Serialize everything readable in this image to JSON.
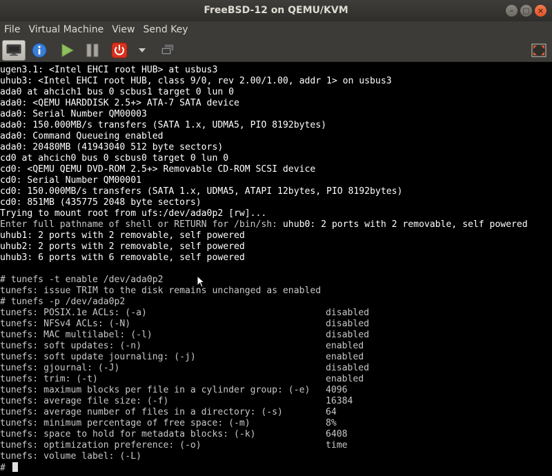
{
  "window": {
    "title": "FreeBSD-12 on QEMU/KVM",
    "controls": [
      "–",
      "□",
      "×"
    ]
  },
  "menubar": {
    "items": [
      "File",
      "Virtual Machine",
      "View",
      "Send Key"
    ]
  },
  "toolbar": {
    "buttons": [
      {
        "name": "console-button",
        "icon": "monitor-icon",
        "active": true
      },
      {
        "name": "details-button",
        "icon": "info-icon"
      },
      {
        "name": "run-button",
        "icon": "play-icon"
      },
      {
        "name": "pause-button",
        "icon": "pause-icon"
      },
      {
        "name": "shutdown-button",
        "icon": "power-icon"
      },
      {
        "name": "shutdown-menu-button",
        "icon": "chevron-down-icon"
      },
      {
        "name": "snapshots-button",
        "icon": "snapshots-icon"
      },
      {
        "name": "fullscreen-button",
        "icon": "fullscreen-icon"
      }
    ]
  },
  "console": {
    "boot_lines": [
      {
        "text": "ugen3.1: <Intel EHCI root HUB> at usbus3",
        "bright": true
      },
      {
        "text": "uhub3: <Intel EHCI root HUB, class 9/0, rev 2.00/1.00, addr 1> on usbus3",
        "bright": true
      },
      {
        "text": "ada0 at ahcich1 bus 0 scbus1 target 0 lun 0",
        "bright": true
      },
      {
        "text": "ada0: <QEMU HARDDISK 2.5+> ATA-7 SATA device",
        "bright": true
      },
      {
        "text": "ada0: Serial Number QM00003",
        "bright": true
      },
      {
        "text": "ada0: 150.000MB/s transfers (SATA 1.x, UDMA5, PIO 8192bytes)",
        "bright": true
      },
      {
        "text": "ada0: Command Queueing enabled",
        "bright": true
      },
      {
        "text": "ada0: 20480MB (41943040 512 byte sectors)",
        "bright": true
      },
      {
        "text": "cd0 at ahcich0 bus 0 scbus0 target 0 lun 0",
        "bright": true
      },
      {
        "text": "cd0: <QEMU QEMU DVD-ROM 2.5+> Removable CD-ROM SCSI device",
        "bright": true
      },
      {
        "text": "cd0: Serial Number QM00001",
        "bright": true
      },
      {
        "text": "cd0: 150.000MB/s transfers (SATA 1.x, UDMA5, ATAPI 12bytes, PIO 8192bytes)",
        "bright": true
      },
      {
        "text": "cd0: 851MB (435775 2048 byte sectors)",
        "bright": true
      },
      {
        "text": "Trying to mount root from ufs:/dev/ada0p2 [rw]...",
        "bright": true
      }
    ],
    "shell_prompt_line": {
      "prefix": "Enter full pathname of shell or RETURN for /bin/sh: ",
      "suffix": "uhub0: 2 ports with 2 removable, self powered"
    },
    "usb_lines": [
      "uhub1: 2 ports with 2 removable, self powered",
      "uhub2: 2 ports with 2 removable, self powered",
      "uhub3: 6 ports with 6 removable, self powered"
    ],
    "session_lines": [
      "",
      "# tunefs -t enable /dev/ada0p2",
      "tunefs: issue TRIM to the disk remains unchanged as enabled",
      "# tunefs -p /dev/ada0p2"
    ],
    "tunefs_rows": [
      {
        "label": "tunefs: POSIX.1e ACLs: (-a)",
        "value": "disabled"
      },
      {
        "label": "tunefs: NFSv4 ACLs: (-N)",
        "value": "disabled"
      },
      {
        "label": "tunefs: MAC multilabel: (-l)",
        "value": "disabled"
      },
      {
        "label": "tunefs: soft updates: (-n)",
        "value": "enabled"
      },
      {
        "label": "tunefs: soft update journaling: (-j)",
        "value": "enabled"
      },
      {
        "label": "tunefs: gjournal: (-J)",
        "value": "disabled"
      },
      {
        "label": "tunefs: trim: (-t)",
        "value": "enabled"
      },
      {
        "label": "tunefs: maximum blocks per file in a cylinder group: (-e)",
        "value": "4096"
      },
      {
        "label": "tunefs: average file size: (-f)",
        "value": "16384"
      },
      {
        "label": "tunefs: average number of files in a directory: (-s)",
        "value": "64"
      },
      {
        "label": "tunefs: minimum percentage of free space: (-m)",
        "value": "8%"
      },
      {
        "label": "tunefs: space to hold for metadata blocks: (-k)",
        "value": "6408"
      },
      {
        "label": "tunefs: optimization preference: (-o)",
        "value": "time"
      },
      {
        "label": "tunefs: volume label: (-L)",
        "value": ""
      }
    ],
    "final_prompt": "# "
  }
}
